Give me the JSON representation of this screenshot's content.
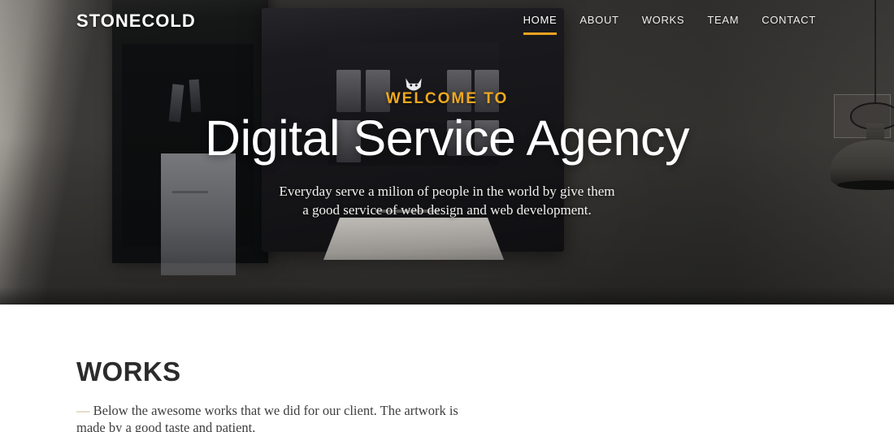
{
  "header": {
    "logo": "STONECOLD",
    "nav": [
      {
        "label": "HOME",
        "active": true
      },
      {
        "label": "ABOUT",
        "active": false
      },
      {
        "label": "WORKS",
        "active": false
      },
      {
        "label": "TEAM",
        "active": false
      },
      {
        "label": "CONTACT",
        "active": false
      }
    ]
  },
  "hero": {
    "eyebrow": "WELCOME TO",
    "title": "Digital Service Agency",
    "subtitle_line1": "Everyday serve a milion of people in the world by give them",
    "subtitle_line2": "a good service of web design and web development.",
    "background": "dark-office-desk-photo"
  },
  "works": {
    "title": "WORKS",
    "dash": "—",
    "description": "Below the awesome works that we did for our client. The artwork is made by a good taste and patient."
  },
  "colors": {
    "accent": "#efa820",
    "accent_underline": "#efa320",
    "hero_overlay": "#3a3937",
    "heading_dark": "#2b2b2b",
    "dash_tan": "#c5b486",
    "page_background": "#ffffff",
    "hero_text": "#ffffff"
  }
}
